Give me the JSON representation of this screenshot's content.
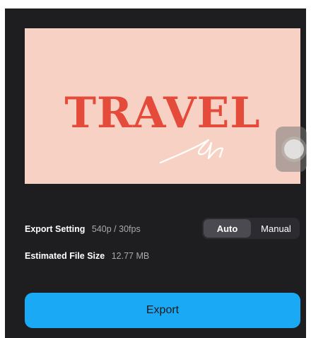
{
  "preview": {
    "title_text": "TRAVEL",
    "background_color": "#f7d2c4",
    "title_color": "#e54b3a"
  },
  "export_setting": {
    "label": "Export Setting",
    "value": "540p / 30fps"
  },
  "estimated_file_size": {
    "label": "Estimated File Size",
    "value": "12.77 MB"
  },
  "mode_toggle": {
    "options": [
      "Auto",
      "Manual"
    ],
    "selected": "Auto"
  },
  "export_button": {
    "label": "Export",
    "color": "#1aaaf5"
  },
  "icons": {
    "assistive_touch": "assistive-touch-icon",
    "signature": "signature-scribble"
  }
}
